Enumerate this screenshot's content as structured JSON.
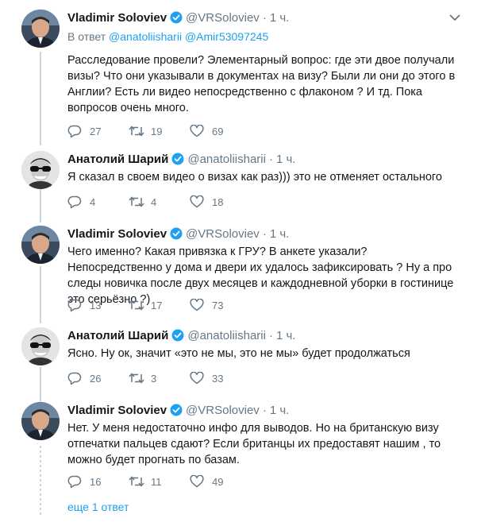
{
  "colors": {
    "accent": "#1da1f2",
    "secondary_text": "#657786",
    "primary_text": "#14171a",
    "thread_line": "#ccd6dd"
  },
  "tweets": [
    {
      "author": "Vladimir Soloviev",
      "handle": "@VRSoloviev",
      "time": "1 ч.",
      "verified": true,
      "avatar_icon": "vladimir-avatar",
      "reply_prefix": "В ответ",
      "reply_mentions": [
        "@anatoliisharii",
        "@Amir53097245"
      ],
      "text": "Расследование провели? Элементарный вопрос: где эти двое получали визы? Что они указывали в документах на визу? Были ли они до этого в Англии? Есть ли видео непосредственно с флаконом ? И тд. Пока вопросов очень много.",
      "replies": "27",
      "retweets": "19",
      "likes": "69"
    },
    {
      "author": "Анатолий Шарий",
      "handle": "@anatoliisharii",
      "time": "1 ч.",
      "verified": true,
      "avatar_icon": "anatoliy-avatar",
      "text": "Я сказал в своем видео о визах как раз))) это не отменяет остального",
      "replies": "4",
      "retweets": "4",
      "likes": "18"
    },
    {
      "author": "Vladimir Soloviev",
      "handle": "@VRSoloviev",
      "time": "1 ч.",
      "verified": true,
      "avatar_icon": "vladimir-avatar",
      "text": "Чего именно? Какая привязка к ГРУ? В анкете указали? Непосредственно у дома и двери их удалось зафиксировать ? Ну а про следы новичка после двух месяцев и каждодневной уборки в гостинице это серьёзно ?)",
      "replies": "13",
      "retweets": "17",
      "likes": "73"
    },
    {
      "author": "Анатолий Шарий",
      "handle": "@anatoliisharii",
      "time": "1 ч.",
      "verified": true,
      "avatar_icon": "anatoliy-avatar",
      "text": "Ясно. Ну ок, значит «это не мы, это не мы» будет продолжаться",
      "replies": "26",
      "retweets": "3",
      "likes": "33"
    },
    {
      "author": "Vladimir Soloviev",
      "handle": "@VRSoloviev",
      "time": "1 ч.",
      "verified": true,
      "avatar_icon": "vladimir-avatar",
      "text": "Нет. У меня недостаточно инфо для выводов. Но на британскую визу отпечатки пальцев сдают? Если британцы их предоставят нашим , то можно будет прогнать по базам.",
      "replies": "16",
      "retweets": "11",
      "likes": "49"
    }
  ],
  "more_replies_label": "еще 1 ответ"
}
